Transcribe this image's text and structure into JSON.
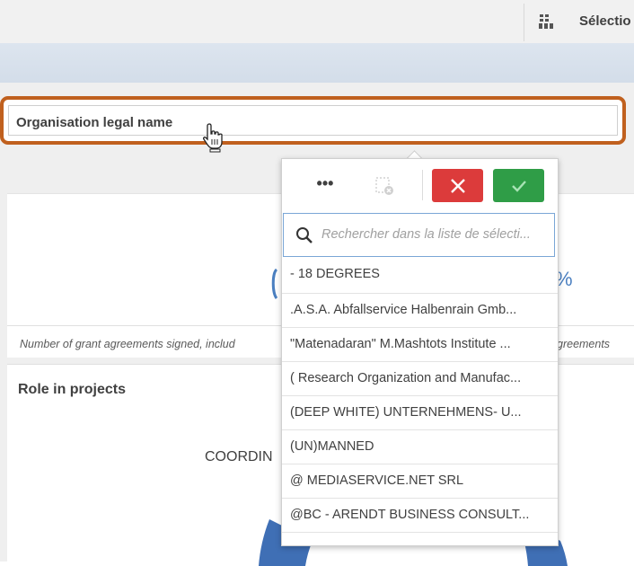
{
  "topbar": {
    "selections_label": "Sélectio",
    "selections_icon": "selections-grid-icon"
  },
  "filter": {
    "label": "Organisation legal name",
    "highlight_color": "#c0601e"
  },
  "kpi": {
    "note_left": "Number of grant agreements signed, includ",
    "note_right": "greements",
    "percent_fragment": "%"
  },
  "role": {
    "title": "Role in projects",
    "coordinator_fragment": "COORDIN"
  },
  "popup": {
    "more_label": "•••",
    "search_placeholder": "Rechercher dans la liste de sélecti...",
    "cancel_color": "#dc3b3b",
    "confirm_color": "#2f9d47",
    "items": [
      "- 18 DEGREES",
      ".A.S.A. Abfallservice Halbenrain Gmb...",
      "\"Matenadaran\" M.Mashtots Institute ...",
      "( Research Organization and Manufac...",
      "(DEEP WHITE) UNTERNEHMENS- U...",
      "(UN)MANNED",
      "@ MEDIASERVICE.NET SRL",
      "@BC - ARENDT BUSINESS CONSULT..."
    ]
  }
}
